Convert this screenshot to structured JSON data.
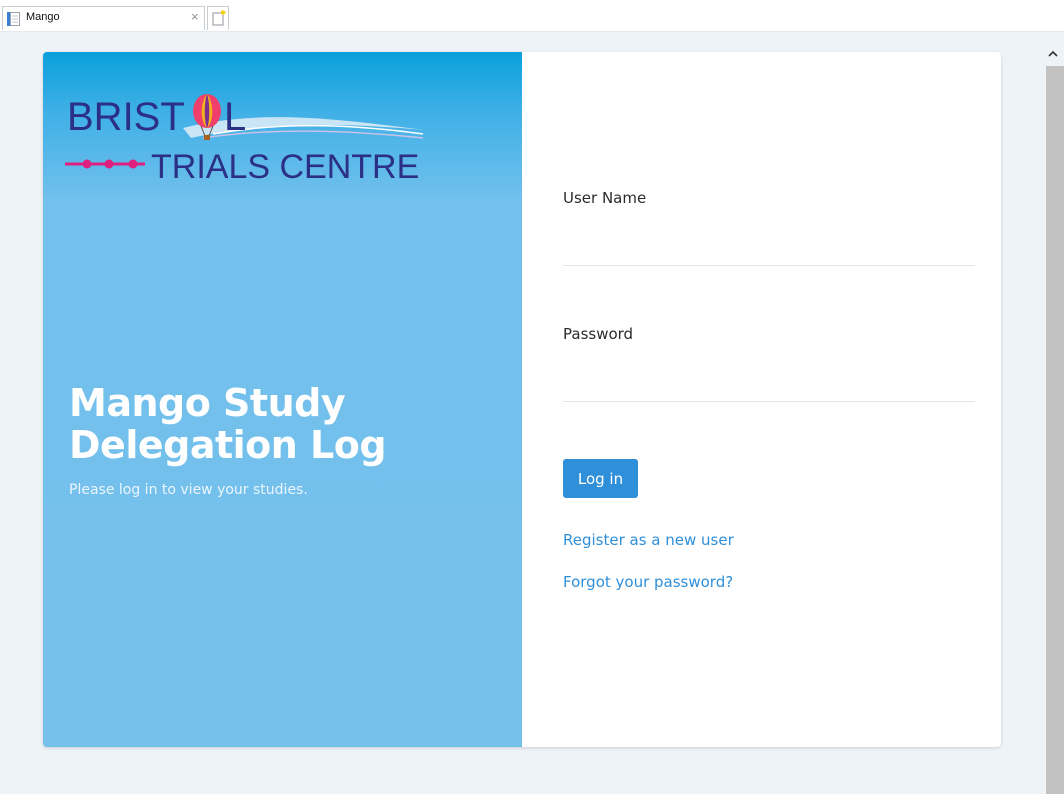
{
  "browser": {
    "tab_title": "Mango",
    "close_glyph": "×",
    "scroll_up_glyph": "^"
  },
  "logo": {
    "line1_left": "BRIST",
    "line1_right": "L",
    "line2": "TRIALS CENTRE"
  },
  "hero": {
    "title_line1": "Mango Study",
    "title_line2": "Delegation Log",
    "subtitle": "Please log in to view your studies."
  },
  "form": {
    "username_label": "User Name",
    "username_value": "",
    "password_label": "Password",
    "password_value": "",
    "login_label": "Log in",
    "register_link": "Register as a new user",
    "forgot_link": "Forgot your password?"
  },
  "colors": {
    "accent": "#2f8fd8",
    "panel_blue": "#76c1ec",
    "logo_navy": "#2b2f86",
    "logo_pink": "#e0207e"
  }
}
